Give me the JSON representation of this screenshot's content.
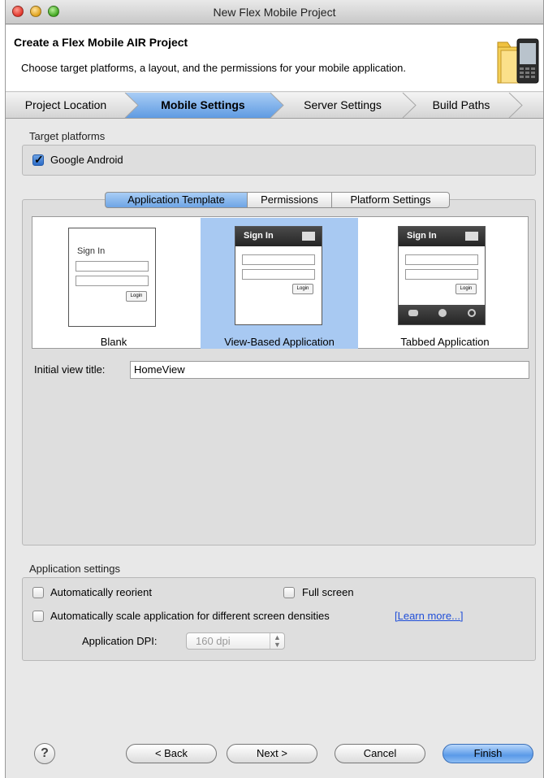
{
  "window": {
    "title": "New Flex Mobile Project"
  },
  "header": {
    "title": "Create a Flex Mobile AIR Project",
    "description": "Choose target platforms, a layout, and the permissions for your mobile application.",
    "icon": "folder-phone-icon"
  },
  "steps": [
    {
      "label": "Project Location",
      "active": false
    },
    {
      "label": "Mobile Settings",
      "active": true
    },
    {
      "label": "Server Settings",
      "active": false
    },
    {
      "label": "Build Paths",
      "active": false
    }
  ],
  "target_platforms": {
    "group_label": "Target platforms",
    "items": [
      {
        "label": "Google Android",
        "checked": true
      }
    ]
  },
  "settings_tabs": [
    {
      "label": "Application Template",
      "active": true
    },
    {
      "label": "Permissions",
      "active": false
    },
    {
      "label": "Platform Settings",
      "active": false
    }
  ],
  "templates": [
    {
      "label": "Blank",
      "selected": false,
      "preview": {
        "title": "Sign In",
        "button": "Login"
      }
    },
    {
      "label": "View-Based Application",
      "selected": true,
      "preview": {
        "title": "Sign In",
        "button": "Login"
      }
    },
    {
      "label": "Tabbed Application",
      "selected": false,
      "preview": {
        "title": "Sign In",
        "button": "Login"
      }
    }
  ],
  "initial_view": {
    "label": "Initial view title:",
    "value": "HomeView"
  },
  "app_settings": {
    "group_label": "Application settings",
    "reorient": {
      "label": "Automatically reorient",
      "checked": false
    },
    "fullscreen": {
      "label": "Full screen",
      "checked": false
    },
    "scale": {
      "label": "Automatically scale application for different screen densities",
      "checked": false
    },
    "learn_more": "[Learn more...]",
    "dpi_label": "Application DPI:",
    "dpi_value": "160 dpi"
  },
  "buttons": {
    "help": "?",
    "back": "< Back",
    "next": "Next >",
    "cancel": "Cancel",
    "finish": "Finish"
  },
  "colors": {
    "accent": "#6ea5e5",
    "selection": "#a8c9f2",
    "link": "#1f4ed8"
  }
}
